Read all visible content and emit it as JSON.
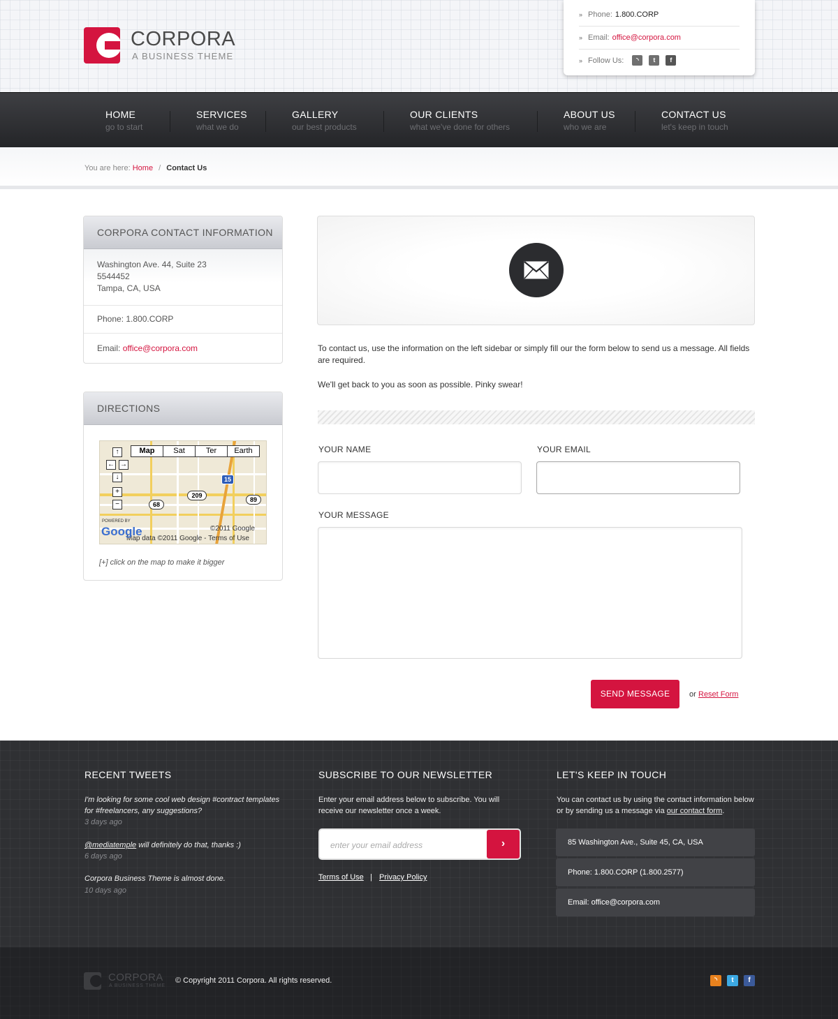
{
  "brand": {
    "name": "CORPORA",
    "tagline": "A BUSINESS THEME",
    "color": "#d4143f"
  },
  "header_contact": {
    "phone_label": "Phone:",
    "phone": "1.800.CORP",
    "email_label": "Email:",
    "email": "office@corpora.com",
    "follow_label": "Follow Us:",
    "social_icons": [
      "rss-icon",
      "twitter-icon",
      "facebook-icon"
    ]
  },
  "nav": [
    {
      "title": "HOME",
      "subtitle": "go to start"
    },
    {
      "title": "SERVICES",
      "subtitle": "what we do"
    },
    {
      "title": "GALLERY",
      "subtitle": "our best products"
    },
    {
      "title": "OUR CLIENTS",
      "subtitle": "what we've done for others"
    },
    {
      "title": "ABOUT US",
      "subtitle": "who we are"
    },
    {
      "title": "CONTACT US",
      "subtitle": "let's keep in touch"
    }
  ],
  "breadcrumb": {
    "prefix": "You are here:",
    "home": "Home",
    "separator": "/",
    "current": "Contact Us"
  },
  "contact_info": {
    "title": "CORPORA CONTACT INFORMATION",
    "address": [
      "Washington Ave. 44, Suite 23",
      "5544452",
      "Tampa, CA, USA"
    ],
    "phone": "Phone: 1.800.CORP",
    "email_label": "Email:",
    "email": "office@corpora.com"
  },
  "directions": {
    "title": "DIRECTIONS",
    "map_tabs": [
      "Map",
      "Sat",
      "Ter",
      "Earth"
    ],
    "map_labels": [
      "209",
      "68",
      "89",
      "15",
      "©2011 Google",
      "Map data ©2011 Google - Terms of Use",
      "POWERED BY",
      "Google"
    ],
    "note": "[+] click on the map to make it bigger"
  },
  "intro": {
    "p1": "To contact us, use the information on the left sidebar or simply fill our the form below to send us a message. All fields are required.",
    "p2": "We'll get back to you as soon as possible. Pinky swear!"
  },
  "form": {
    "name_label": "YOUR NAME",
    "email_label": "YOUR EMAIL",
    "message_label": "YOUR MESSAGE",
    "name_value": "",
    "email_value": "",
    "message_value": "",
    "send_label": "SEND MESSAGE",
    "or_text": "or",
    "reset_label": "Reset Form"
  },
  "footer": {
    "tweets_title": "RECENT TWEETS",
    "tweets": [
      {
        "text": "I'm looking for some cool web design #contract templates for #freelancers, any suggestions?",
        "date": "3 days ago"
      },
      {
        "mention": "@mediatemple",
        "text": " will definitely do that, thanks :)",
        "date": "6 days ago"
      },
      {
        "text": "Corpora Business Theme is almost done.",
        "date": "10 days ago"
      }
    ],
    "newsletter_title": "SUBSCRIBE TO OUR NEWSLETTER",
    "newsletter_text": "Enter your email address below to subscribe. You will receive our newsletter once a week.",
    "newsletter_placeholder": "enter your email address",
    "newsletter_button": "›",
    "terms": "Terms of Use",
    "divider": "|",
    "privacy": "Privacy Policy",
    "touch_title": "LET'S KEEP IN TOUCH",
    "touch_text_1": "You can contact us by using the contact information below or by sending us a message via ",
    "touch_link": "our contact form",
    "touch_text_2": ".",
    "touch_address": "85 Washington Ave., Suite 45, CA, USA",
    "touch_phone": "Phone: 1.800.CORP (1.800.2577)",
    "touch_email": "Email: office@corpora.com"
  },
  "bottom": {
    "logo_name": "CORPORA",
    "logo_tagline": "A BUSINESS THEME",
    "copyright": "© Copyright 2011 Corpora. All rights reserved.",
    "social_icons": [
      "rss-icon",
      "twitter-icon",
      "facebook-icon"
    ]
  }
}
